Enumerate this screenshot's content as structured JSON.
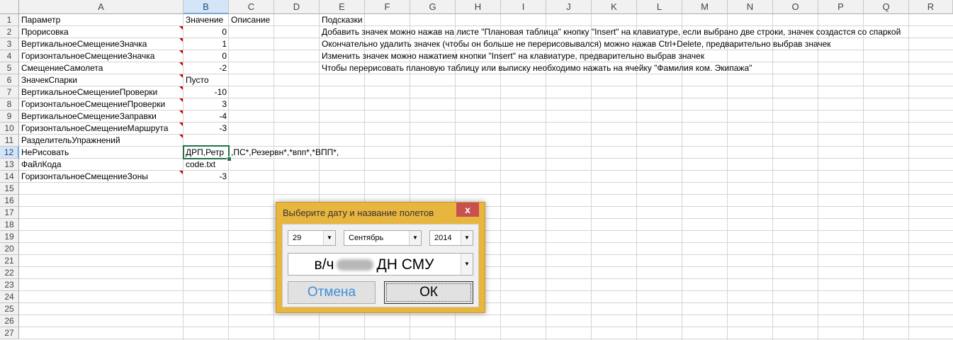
{
  "columns": [
    "A",
    "B",
    "C",
    "D",
    "E",
    "F",
    "G",
    "H",
    "I",
    "J",
    "K",
    "L",
    "M",
    "N",
    "O",
    "P",
    "Q",
    "R"
  ],
  "rows": [
    "1",
    "2",
    "3",
    "4",
    "5",
    "6",
    "7",
    "8",
    "9",
    "10",
    "11",
    "12",
    "13",
    "14",
    "15",
    "16",
    "17",
    "18",
    "19",
    "20",
    "21",
    "22",
    "23",
    "24",
    "25",
    "26",
    "27"
  ],
  "cells": {
    "r1": {
      "a": "Параметр",
      "b": "Значение",
      "c": "Описание",
      "e": "Подсказки"
    },
    "r2": {
      "a": "Прорисовка",
      "b": "0",
      "e": "Добавить значек можно нажав на листе \"Плановая таблица\" кнопку \"Insert\" на клавиатуре, если выбрано две строки, значек создастся со спаркой"
    },
    "r3": {
      "a": "ВертикальноеСмещениеЗначка",
      "b": "1",
      "e": "Окончательно удалить значек (чтобы он больше не перерисовывался) можно нажав Ctrl+Delete, предварительно выбрав значек"
    },
    "r4": {
      "a": "ГоризонтальноеСмещениеЗначка",
      "b": "0",
      "e": "Изменить значек можно нажатием кнопки \"Insert\" на клавиатуре, предварительно выбрав значек"
    },
    "r5": {
      "a": "СмещениеСамолета",
      "b": "-2",
      "e": "Чтобы перерисовать плановую таблицу или выписку необходимо нажать на ячейку \"Фамилия ком. Экипажа\""
    },
    "r6": {
      "a": "ЗначекСпарки",
      "b": "Пусто"
    },
    "r7": {
      "a": "ВертикальноеСмещениеПроверки",
      "b": "-10"
    },
    "r8": {
      "a": "ГоризонтальноеСмещениеПроверки",
      "b": "3"
    },
    "r9": {
      "a": "ВертикальноеСмещениеЗаправки",
      "b": "-4"
    },
    "r10": {
      "a": "ГоризонтальноеСмещениеМаршрута",
      "b": "-3"
    },
    "r11": {
      "a": "РазделительУпражнений"
    },
    "r12": {
      "a": "НеРисовать",
      "b": "ДРП,Ретр",
      "c": ",ПС*,Резервн*,*впп*,*ВПП*,"
    },
    "r13": {
      "a": "ФайлКода",
      "b": "code.txt"
    },
    "r14": {
      "a": "ГоризонтальноеСмещениеЗоны",
      "b": "-3"
    }
  },
  "dialog": {
    "title": "Выберите дату и название полетов",
    "close": "x",
    "day": "29",
    "month": "Сентябрь",
    "year": "2014",
    "unit_prefix": "в/ч",
    "unit_suffix": "ДН СМУ",
    "cancel_label": "Отмена",
    "ok_label": "ОК"
  },
  "icons": {
    "dropdown": "▼"
  },
  "colors": {
    "dialog_frame": "#e8b53f",
    "close_button": "#c75050",
    "selection": "#217346"
  }
}
